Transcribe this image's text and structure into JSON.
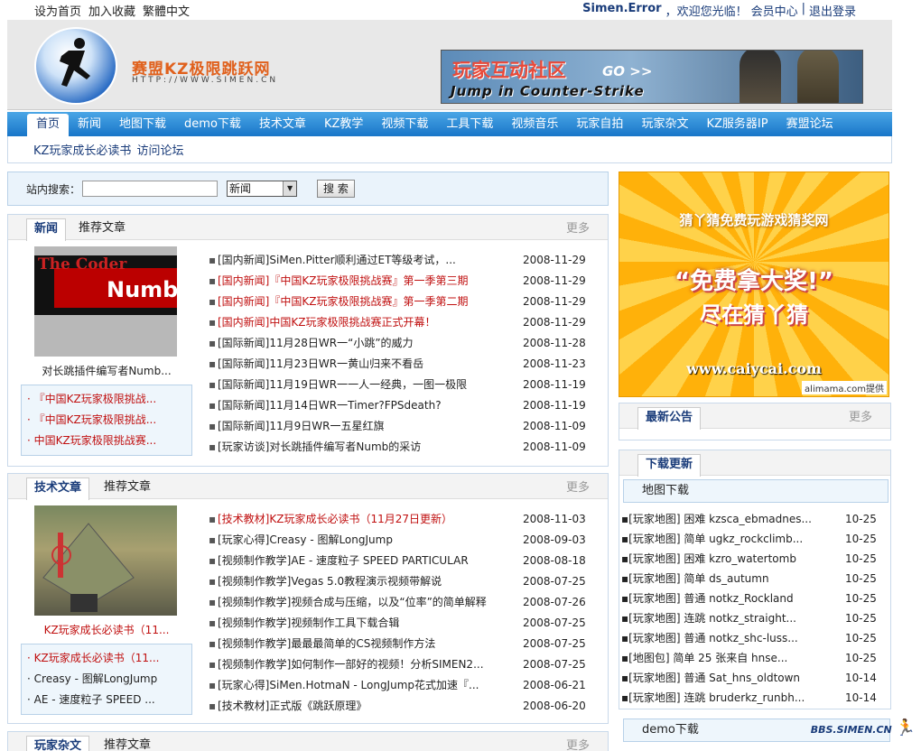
{
  "top": {
    "links": [
      "设为首页",
      "加入收藏",
      "繁體中文"
    ],
    "user": "Simen.Error",
    "welcome": "，欢迎您光临！",
    "member": "会员中心",
    "sep": "|",
    "logout": "退出登录"
  },
  "header": {
    "logo_text": "赛盟KZ极限跳跃网",
    "logo_url": "HTTP://WWW.SIMEN.CN",
    "banner_line1": "玩家互动社区",
    "banner_go": "GO >>",
    "banner_line2": "Jump in Counter-Strike"
  },
  "nav": [
    "首页",
    "新闻",
    "地图下载",
    "demo下载",
    "技术文章",
    "KZ教学",
    "视频下载",
    "工具下载",
    "视频音乐",
    "玩家自拍",
    "玩家杂文",
    "KZ服务器IP",
    "赛盟论坛"
  ],
  "subnav": [
    "KZ玩家成长必读书",
    "访问论坛"
  ],
  "search": {
    "label": "站内搜索：",
    "value": "",
    "selected": "新闻",
    "button": "搜 索"
  },
  "news": {
    "tabs": [
      "新闻",
      "推荐文章"
    ],
    "more": "更多",
    "thumb_text": [
      "The Coder",
      "Numb"
    ],
    "caption": "对长跳插件编写者Numb...",
    "side": [
      "『中国KZ玩家极限挑战...",
      "『中国KZ玩家极限挑战...",
      "中国KZ玩家极限挑战赛..."
    ],
    "items": [
      {
        "title": "[国内新闻]SiMen.Pitter顺利通过ET等级考试，...",
        "date": "2008-11-29",
        "red": false
      },
      {
        "title": "[国内新闻]『中国KZ玩家极限挑战赛』第一季第三期",
        "date": "2008-11-29",
        "red": true
      },
      {
        "title": "[国内新闻]『中国KZ玩家极限挑战赛』第一季第二期",
        "date": "2008-11-29",
        "red": true
      },
      {
        "title": "[国内新闻]中国KZ玩家极限挑战赛正式开幕！",
        "date": "2008-11-29",
        "red": true
      },
      {
        "title": "[国际新闻]11月28日WR一“小跳”的威力",
        "date": "2008-11-28",
        "red": false
      },
      {
        "title": "[国际新闻]11月23日WR一黄山归来不看岳",
        "date": "2008-11-23",
        "red": false
      },
      {
        "title": "[国际新闻]11月19日WR一一人一经典，一图一极限",
        "date": "2008-11-19",
        "red": false
      },
      {
        "title": "[国际新闻]11月14日WR一Timer?FPSdeath?",
        "date": "2008-11-19",
        "red": false
      },
      {
        "title": "[国际新闻]11月9日WR一五星红旗",
        "date": "2008-11-09",
        "red": false
      },
      {
        "title": "[玩家访谈]对长跳插件编写者Numb的采访",
        "date": "2008-11-09",
        "red": false
      }
    ]
  },
  "tech": {
    "tabs": [
      "技术文章",
      "推荐文章"
    ],
    "more": "更多",
    "caption": "KZ玩家成长必读书（11...",
    "side": [
      "KZ玩家成长必读书（11...",
      "Creasy - 图解LongJump",
      "AE - 速度粒子 SPEED ..."
    ],
    "items": [
      {
        "title": "[技术教材]KZ玩家成长必读书（11月27日更新）",
        "date": "2008-11-03",
        "red": true
      },
      {
        "title": "[玩家心得]Creasy - 图解LongJump",
        "date": "2008-09-03",
        "red": false
      },
      {
        "title": "[视频制作教学]AE - 速度粒子 SPEED PARTICULAR",
        "date": "2008-08-18",
        "red": false
      },
      {
        "title": "[视频制作教学]Vegas 5.0教程演示视频带解说",
        "date": "2008-07-25",
        "red": false
      },
      {
        "title": "[视频制作教学]视频合成与压缩，以及“位率”的简单解释",
        "date": "2008-07-26",
        "red": false
      },
      {
        "title": "[视频制作教学]视频制作工具下载合辑",
        "date": "2008-07-25",
        "red": false
      },
      {
        "title": "[视频制作教学]最最最简单的CS视频制作方法",
        "date": "2008-07-25",
        "red": false
      },
      {
        "title": "[视频制作教学]如何制作一部好的视频！分析SIMEN2...",
        "date": "2008-07-25",
        "red": false
      },
      {
        "title": "[玩家心得]SiMen.HotmaN - LongJump花式加速『...",
        "date": "2008-06-21",
        "red": false
      },
      {
        "title": "[技术教材]正式版《跳跃原理》",
        "date": "2008-06-20",
        "red": false
      }
    ]
  },
  "essays": {
    "tabs": [
      "玩家杂文",
      "推荐文章"
    ],
    "more": "更多"
  },
  "ad": {
    "headline": "猜丫猜免费玩游戏猜奖网",
    "big1": "“免费拿大奖!”",
    "big2": "尽在猜丫猜",
    "url": "www.caiycai.com",
    "provider": "alimama.com提供"
  },
  "notice": {
    "tab": "最新公告",
    "more": "更多"
  },
  "downloads": {
    "tab": "下载更新",
    "section": "地图下载",
    "items": [
      {
        "title": "[玩家地图] 困难 kzsca_ebmadnes...",
        "date": "10-25"
      },
      {
        "title": "[玩家地图] 简单 ugkz_rockclimb...",
        "date": "10-25"
      },
      {
        "title": "[玩家地图] 困难 kzro_watertomb",
        "date": "10-25"
      },
      {
        "title": "[玩家地图] 简单 ds_autumn",
        "date": "10-25"
      },
      {
        "title": "[玩家地图] 普通 notkz_Rockland",
        "date": "10-25"
      },
      {
        "title": "[玩家地图] 连跳 notkz_straight...",
        "date": "10-25"
      },
      {
        "title": "[玩家地图] 普通 notkz_shc-luss...",
        "date": "10-25"
      },
      {
        "title": "[地图包] 简单 25 张来自 hnse...",
        "date": "10-25"
      },
      {
        "title": "[玩家地图] 普通 Sat_hns_oldtown",
        "date": "10-14"
      },
      {
        "title": "[玩家地图] 连跳 bruderkz_runbh...",
        "date": "10-14"
      }
    ],
    "demo_section": "demo下载"
  },
  "footer_logo": "BBS.SIMEN.CN"
}
